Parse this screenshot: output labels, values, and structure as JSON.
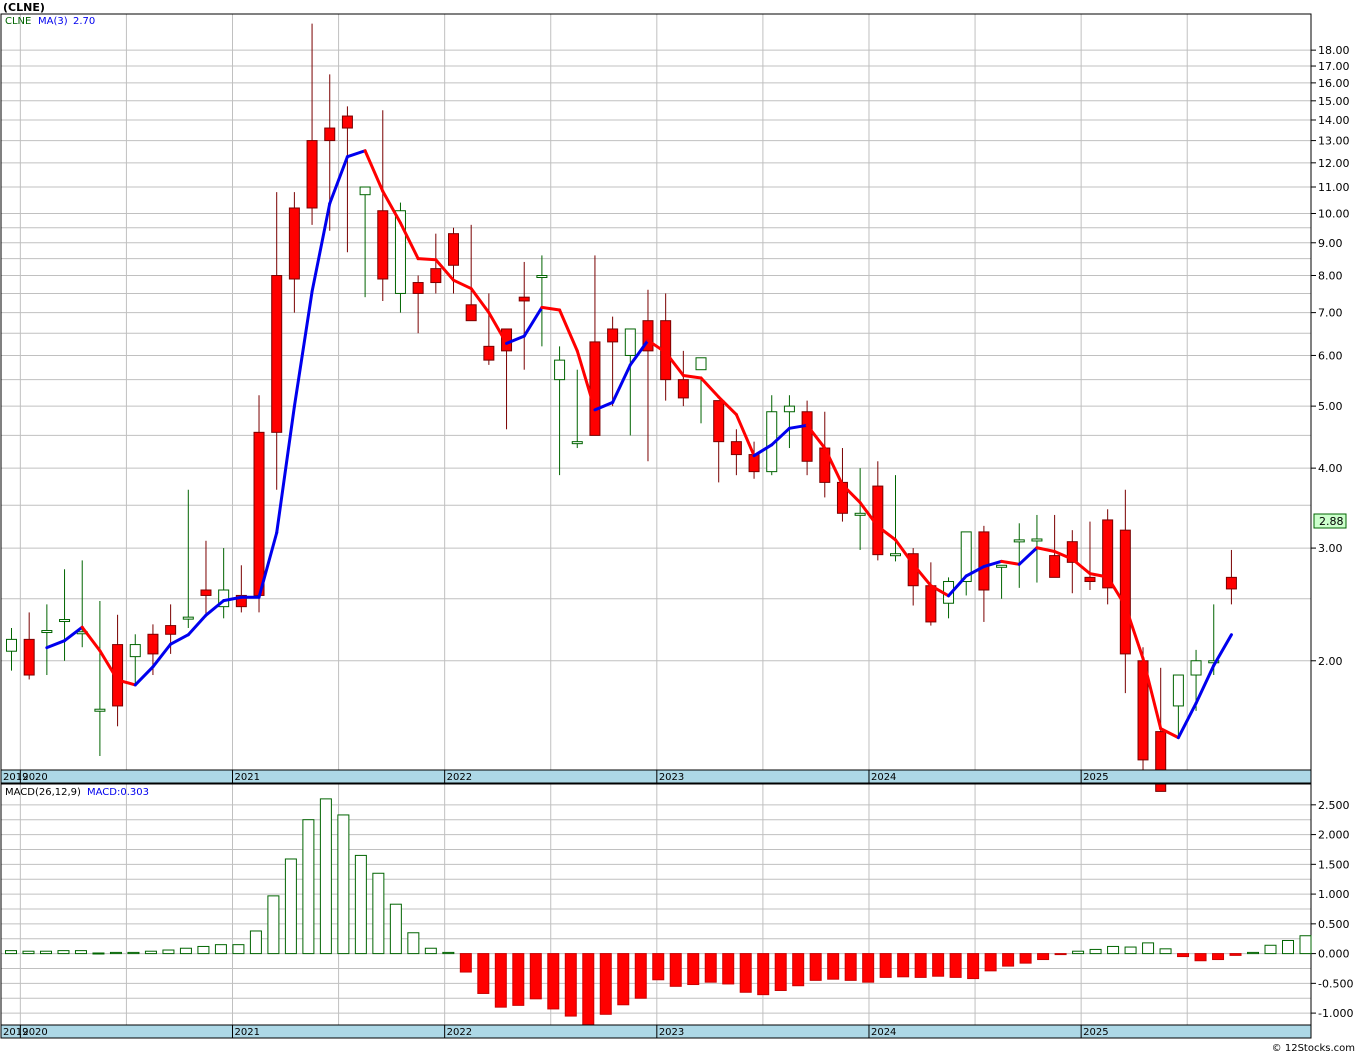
{
  "header": {
    "title": "(CLNE)",
    "ticker": "CLNE",
    "ma_label": "MA(3)",
    "ma_value": "2.70",
    "last_price": "2.88",
    "macd_label": "MACD(26,12,9)",
    "macd_value": "MACD:0.303",
    "watermark": "© 12Stocks.com"
  },
  "colors": {
    "up_fill": "#ffffff",
    "up_stroke": "#006400",
    "down_fill": "#ff0000",
    "down_stroke": "#7a0000",
    "ma_up": "#0000ee",
    "ma_down": "#ff0000",
    "axis_band": "#add8e6",
    "grid": "#c0c0c0"
  },
  "chart_data": [
    {
      "type": "candlestick",
      "interval": "monthly",
      "scale": "log",
      "ylim": [
        1.35,
        20.5
      ],
      "y_ticks": [
        "18.00",
        "17.00",
        "16.00",
        "15.00",
        "14.00",
        "13.00",
        "12.00",
        "11.00",
        "10.00",
        "9.00",
        "8.00",
        "7.00",
        "6.00",
        "5.00",
        "4.00",
        "3.00",
        "2.00"
      ],
      "x_ticks": [
        "2019",
        "2020",
        "2021",
        "2022",
        "2023",
        "2024",
        "2025"
      ],
      "months": [
        "2019-12",
        "2020-01",
        "2020-02",
        "2020-03",
        "2020-04",
        "2020-05",
        "2020-06",
        "2020-07",
        "2020-08",
        "2020-09",
        "2020-10",
        "2020-11",
        "2020-12",
        "2021-01",
        "2021-02",
        "2021-03",
        "2021-04",
        "2021-05",
        "2021-06",
        "2021-07",
        "2021-08",
        "2021-09",
        "2021-10",
        "2021-11",
        "2021-12",
        "2022-01",
        "2022-02",
        "2022-03",
        "2022-04",
        "2022-05",
        "2022-06",
        "2022-07",
        "2022-08",
        "2022-09",
        "2022-10",
        "2022-11",
        "2022-12",
        "2023-01",
        "2023-02",
        "2023-03",
        "2023-04",
        "2023-05",
        "2023-06",
        "2023-07",
        "2023-08",
        "2023-09",
        "2023-10",
        "2023-11",
        "2023-12",
        "2024-01",
        "2024-02",
        "2024-03",
        "2024-04",
        "2024-05",
        "2024-06",
        "2024-07",
        "2024-08",
        "2024-09",
        "2024-10",
        "2024-11",
        "2024-12",
        "2025-01",
        "2025-02",
        "2025-03",
        "2025-04",
        "2025-05",
        "2025-06",
        "2025-07",
        "2025-08",
        "2025-09"
      ],
      "open": [
        2.07,
        2.16,
        2.23,
        2.32,
        2.22,
        1.68,
        2.12,
        2.03,
        2.2,
        2.27,
        2.34,
        2.58,
        2.43,
        2.53,
        4.55,
        8.0,
        10.2,
        13.0,
        13.6,
        14.2,
        10.7,
        10.1,
        7.5,
        7.8,
        8.2,
        9.3,
        7.2,
        6.2,
        6.6,
        7.4,
        8.0,
        5.5,
        4.4,
        6.3,
        6.6,
        6.0,
        6.8,
        6.8,
        5.5,
        5.7,
        5.1,
        4.4,
        4.2,
        3.95,
        4.9,
        4.9,
        4.3,
        3.8,
        3.4,
        3.75,
        2.93,
        2.94,
        2.62,
        2.46,
        2.66,
        3.18,
        2.82,
        3.09,
        3.1,
        2.92,
        3.07,
        2.7,
        3.32,
        3.2,
        2.0,
        1.55,
        1.7,
        1.9,
        2.0,
        2.7
      ],
      "high": [
        2.25,
        2.38,
        2.45,
        2.78,
        2.87,
        2.48,
        2.36,
        2.2,
        2.28,
        2.45,
        3.7,
        3.08,
        3.0,
        2.82,
        5.2,
        10.8,
        10.8,
        19.8,
        16.5,
        14.7,
        10.8,
        14.5,
        10.4,
        8.0,
        9.3,
        9.5,
        9.6,
        7.5,
        6.3,
        8.4,
        8.6,
        6.2,
        5.7,
        8.6,
        6.9,
        6.3,
        7.6,
        7.5,
        6.1,
        5.5,
        5.1,
        4.6,
        4.4,
        5.2,
        5.2,
        5.1,
        4.9,
        4.3,
        4.0,
        4.1,
        3.9,
        3.0,
        2.85,
        2.7,
        3.04,
        3.25,
        2.8,
        3.28,
        3.38,
        3.38,
        3.2,
        3.3,
        3.45,
        3.7,
        2.1,
        1.95,
        1.85,
        2.08,
        2.45,
        2.98
      ],
      "low": [
        1.93,
        1.87,
        1.9,
        2.0,
        2.1,
        1.42,
        1.58,
        1.83,
        1.9,
        2.05,
        2.25,
        2.34,
        2.33,
        2.38,
        2.38,
        3.7,
        7.0,
        9.6,
        9.4,
        8.7,
        7.4,
        7.3,
        7.0,
        6.5,
        7.5,
        7.5,
        6.8,
        5.8,
        4.6,
        5.7,
        6.2,
        3.9,
        4.3,
        6.1,
        5.0,
        4.5,
        4.1,
        5.1,
        5.0,
        4.7,
        3.8,
        3.9,
        3.85,
        3.9,
        4.3,
        3.9,
        3.6,
        3.3,
        2.98,
        2.87,
        2.86,
        2.44,
        2.27,
        2.33,
        2.53,
        2.3,
        2.5,
        2.6,
        2.65,
        2.7,
        2.55,
        2.58,
        2.45,
        1.78,
        1.3,
        1.3,
        1.52,
        1.67,
        1.9,
        2.45
      ],
      "close": [
        2.16,
        1.9,
        2.23,
        2.32,
        2.22,
        1.68,
        1.7,
        2.12,
        2.05,
        2.2,
        2.34,
        2.53,
        2.58,
        2.43,
        2.53,
        4.55,
        7.9,
        10.2,
        13.0,
        13.6,
        11.0,
        7.9,
        10.1,
        7.5,
        7.8,
        8.3,
        6.8,
        5.9,
        6.1,
        7.3,
        8.0,
        5.9,
        4.4,
        4.5,
        6.3,
        6.6,
        6.1,
        5.5,
        5.15,
        5.95,
        4.4,
        4.2,
        3.95,
        4.9,
        5.0,
        4.1,
        3.8,
        3.4,
        3.4,
        2.93,
        2.94,
        2.62,
        2.3,
        2.66,
        3.18,
        2.58,
        2.82,
        3.09,
        3.1,
        2.7,
        2.85,
        2.66,
        2.6,
        2.05,
        1.4,
        1.25,
        1.9,
        2.0,
        2.0,
        2.59
      ]
    },
    {
      "type": "bar",
      "name": "MACD(26,12,9)",
      "ylim": [
        -1.2,
        2.85
      ],
      "y_ticks": [
        "2.500",
        "2.000",
        "1.500",
        "1.000",
        "0.500",
        "0.000",
        "-0.500",
        "-1.000"
      ],
      "values": [
        0.05,
        0.04,
        0.04,
        0.05,
        0.05,
        0.01,
        0.02,
        0.02,
        0.04,
        0.06,
        0.09,
        0.12,
        0.15,
        0.15,
        0.38,
        0.97,
        1.59,
        2.25,
        2.6,
        2.33,
        1.65,
        1.35,
        0.83,
        0.35,
        0.09,
        0.02,
        -0.31,
        -0.67,
        -0.9,
        -0.87,
        -0.76,
        -0.93,
        -1.05,
        -1.21,
        -1.02,
        -0.86,
        -0.75,
        -0.44,
        -0.55,
        -0.52,
        -0.48,
        -0.51,
        -0.65,
        -0.69,
        -0.62,
        -0.54,
        -0.45,
        -0.43,
        -0.45,
        -0.48,
        -0.4,
        -0.39,
        -0.4,
        -0.38,
        -0.4,
        -0.42,
        -0.29,
        -0.21,
        -0.16,
        -0.1,
        -0.01,
        0.04,
        0.07,
        0.12,
        0.11,
        0.18,
        0.08,
        -0.05,
        -0.12,
        -0.1,
        -0.03,
        0.02,
        0.14,
        0.22,
        0.3
      ]
    }
  ]
}
